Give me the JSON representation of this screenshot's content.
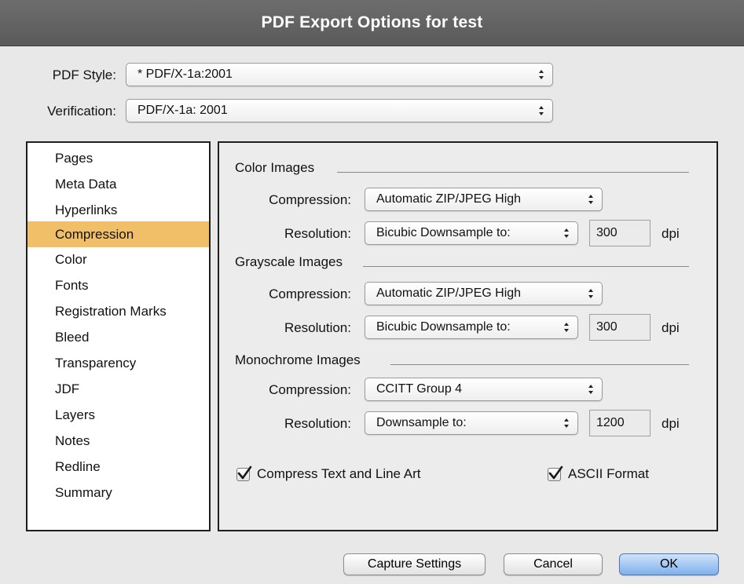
{
  "window": {
    "title": "PDF Export Options for test"
  },
  "top": {
    "pdf_style": {
      "label": "PDF Style:",
      "value": "* PDF/X-1a:2001"
    },
    "verification": {
      "label": "Verification:",
      "value": "PDF/X-1a: 2001"
    }
  },
  "sidebar": {
    "items": [
      {
        "label": "Pages"
      },
      {
        "label": "Meta Data"
      },
      {
        "label": "Hyperlinks"
      },
      {
        "label": "Compression"
      },
      {
        "label": "Color"
      },
      {
        "label": "Fonts"
      },
      {
        "label": "Registration Marks"
      },
      {
        "label": "Bleed"
      },
      {
        "label": "Transparency"
      },
      {
        "label": "JDF"
      },
      {
        "label": "Layers"
      },
      {
        "label": "Notes"
      },
      {
        "label": "Redline"
      },
      {
        "label": "Summary"
      }
    ],
    "selected": "Compression"
  },
  "compression": {
    "labels": {
      "compression": "Compression:",
      "resolution": "Resolution:",
      "unit": "dpi"
    },
    "color": {
      "title": "Color Images",
      "compression": "Automatic ZIP/JPEG High",
      "resolution_method": "Bicubic Downsample to:",
      "resolution_value": "300"
    },
    "grayscale": {
      "title": "Grayscale Images",
      "compression": "Automatic ZIP/JPEG High",
      "resolution_method": "Bicubic Downsample to:",
      "resolution_value": "300"
    },
    "monochrome": {
      "title": "Monochrome Images",
      "compression": "CCITT Group 4",
      "resolution_method": "Downsample to:",
      "resolution_value": "1200"
    },
    "compress_text": {
      "label": "Compress Text and Line Art",
      "checked": true
    },
    "ascii_format": {
      "label": "ASCII Format",
      "checked": true
    }
  },
  "buttons": {
    "capture": "Capture Settings",
    "cancel": "Cancel",
    "ok": "OK"
  },
  "colors": {
    "selection": "#f0bf68",
    "default_button": "#7fb0ec",
    "titlebar": "#5f5f5f"
  }
}
